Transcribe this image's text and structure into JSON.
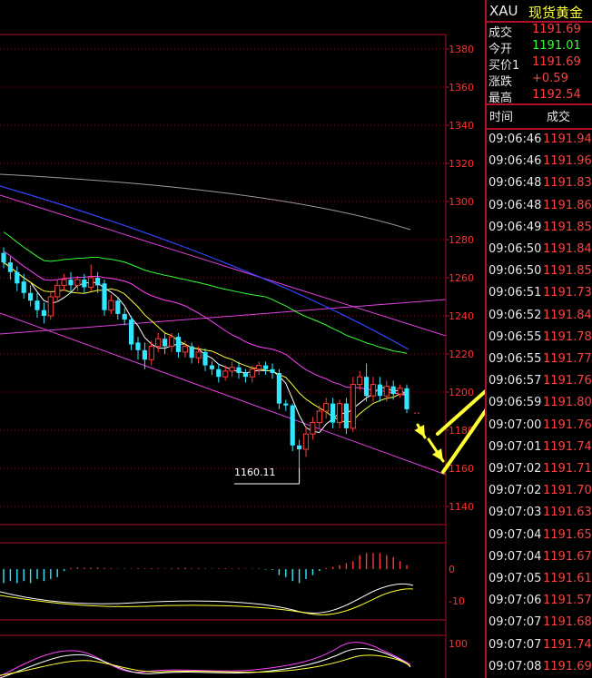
{
  "colors": {
    "up": "#ff3a3a",
    "down": "#33e6ff",
    "axis": "#b0102a",
    "grid": "#7a0f20",
    "price_up": "#ff4040",
    "price_down": "#33ff33",
    "arrow": "#ffff33"
  },
  "quote": {
    "symbol": "XAU",
    "name": "现货黄金",
    "rows": [
      {
        "label": "成交",
        "value": "1191.69",
        "color": "#ff4040"
      },
      {
        "label": "今开",
        "value": "1191.01",
        "color": "#33ff33"
      },
      {
        "label": "买价1",
        "value": "1191.69",
        "color": "#ff4040"
      },
      {
        "label": "涨跌",
        "value": "+0.59",
        "color": "#ff4040"
      },
      {
        "label": "最高",
        "value": "1192.54",
        "color": "#ff4040"
      }
    ],
    "tick_header": {
      "time": "时间",
      "price": "成交"
    },
    "ticks": [
      {
        "time": "09:06:46",
        "price": "1191.94"
      },
      {
        "time": "09:06:46",
        "price": "1191.96"
      },
      {
        "time": "09:06:48",
        "price": "1191.83"
      },
      {
        "time": "09:06:48",
        "price": "1191.86"
      },
      {
        "time": "09:06:49",
        "price": "1191.85"
      },
      {
        "time": "09:06:50",
        "price": "1191.84"
      },
      {
        "time": "09:06:50",
        "price": "1191.85"
      },
      {
        "time": "09:06:51",
        "price": "1191.73"
      },
      {
        "time": "09:06:52",
        "price": "1191.84"
      },
      {
        "time": "09:06:55",
        "price": "1191.78"
      },
      {
        "time": "09:06:55",
        "price": "1191.77"
      },
      {
        "time": "09:06:57",
        "price": "1191.76"
      },
      {
        "time": "09:06:59",
        "price": "1191.80"
      },
      {
        "time": "09:07:00",
        "price": "1191.76"
      },
      {
        "time": "09:07:01",
        "price": "1191.74"
      },
      {
        "time": "09:07:02",
        "price": "1191.71"
      },
      {
        "time": "09:07:02",
        "price": "1191.70"
      },
      {
        "time": "09:07:03",
        "price": "1191.63"
      },
      {
        "time": "09:07:04",
        "price": "1191.65"
      },
      {
        "time": "09:07:04",
        "price": "1191.67"
      },
      {
        "time": "09:07:05",
        "price": "1191.61"
      },
      {
        "time": "09:07:06",
        "price": "1191.57"
      },
      {
        "time": "09:07:07",
        "price": "1191.68"
      },
      {
        "time": "09:07:07",
        "price": "1191.74"
      },
      {
        "time": "09:07:08",
        "price": "1191.69"
      }
    ]
  },
  "chart": {
    "price_axis": [
      "1380",
      "1360",
      "1340",
      "1320",
      "1300",
      "1280",
      "1260",
      "1240",
      "1220",
      "1200",
      "1180",
      "1160",
      "1140"
    ],
    "low_annotation": "1160.11",
    "macd_axis": [
      "0",
      "-10"
    ],
    "kdj_axis": [
      "100"
    ],
    "candles": [
      {
        "o": 1273,
        "c": 1268,
        "h": 1276,
        "l": 1265
      },
      {
        "o": 1268,
        "c": 1263,
        "h": 1271,
        "l": 1259
      },
      {
        "o": 1263,
        "c": 1257,
        "h": 1266,
        "l": 1253
      },
      {
        "o": 1258,
        "c": 1252,
        "h": 1262,
        "l": 1249
      },
      {
        "o": 1252,
        "c": 1248,
        "h": 1256,
        "l": 1245
      },
      {
        "o": 1248,
        "c": 1243,
        "h": 1252,
        "l": 1239
      },
      {
        "o": 1243,
        "c": 1240,
        "h": 1247,
        "l": 1236
      },
      {
        "o": 1240,
        "c": 1250,
        "h": 1253,
        "l": 1238
      },
      {
        "o": 1250,
        "c": 1256,
        "h": 1259,
        "l": 1247
      },
      {
        "o": 1256,
        "c": 1259,
        "h": 1262,
        "l": 1253
      },
      {
        "o": 1259,
        "c": 1256,
        "h": 1263,
        "l": 1252
      },
      {
        "o": 1256,
        "c": 1259,
        "h": 1261,
        "l": 1253
      },
      {
        "o": 1259,
        "c": 1255,
        "h": 1262,
        "l": 1252
      },
      {
        "o": 1255,
        "c": 1260,
        "h": 1267,
        "l": 1253
      },
      {
        "o": 1260,
        "c": 1256,
        "h": 1263,
        "l": 1252
      },
      {
        "o": 1257,
        "c": 1243,
        "h": 1259,
        "l": 1240
      },
      {
        "o": 1243,
        "c": 1248,
        "h": 1251,
        "l": 1241
      },
      {
        "o": 1248,
        "c": 1241,
        "h": 1250,
        "l": 1238
      },
      {
        "o": 1241,
        "c": 1238,
        "h": 1244,
        "l": 1235
      },
      {
        "o": 1238,
        "c": 1225,
        "h": 1240,
        "l": 1222
      },
      {
        "o": 1226,
        "c": 1222,
        "h": 1229,
        "l": 1217
      },
      {
        "o": 1222,
        "c": 1217,
        "h": 1226,
        "l": 1212
      },
      {
        "o": 1217,
        "c": 1224,
        "h": 1227,
        "l": 1214
      },
      {
        "o": 1224,
        "c": 1228,
        "h": 1231,
        "l": 1221
      },
      {
        "o": 1228,
        "c": 1224,
        "h": 1231,
        "l": 1220
      },
      {
        "o": 1224,
        "c": 1229,
        "h": 1231,
        "l": 1221
      },
      {
        "o": 1229,
        "c": 1221,
        "h": 1231,
        "l": 1218
      },
      {
        "o": 1221,
        "c": 1224,
        "h": 1227,
        "l": 1218
      },
      {
        "o": 1224,
        "c": 1218,
        "h": 1226,
        "l": 1215
      },
      {
        "o": 1218,
        "c": 1221,
        "h": 1224,
        "l": 1215
      },
      {
        "o": 1221,
        "c": 1214,
        "h": 1223,
        "l": 1211
      },
      {
        "o": 1214,
        "c": 1212,
        "h": 1216,
        "l": 1209
      },
      {
        "o": 1212,
        "c": 1208,
        "h": 1215,
        "l": 1205
      },
      {
        "o": 1208,
        "c": 1211,
        "h": 1214,
        "l": 1206
      },
      {
        "o": 1211,
        "c": 1213,
        "h": 1216,
        "l": 1208
      },
      {
        "o": 1213,
        "c": 1210,
        "h": 1216,
        "l": 1207
      },
      {
        "o": 1210,
        "c": 1208,
        "h": 1212,
        "l": 1205
      },
      {
        "o": 1208,
        "c": 1212,
        "h": 1214,
        "l": 1205
      },
      {
        "o": 1212,
        "c": 1214,
        "h": 1216,
        "l": 1209
      },
      {
        "o": 1214,
        "c": 1212,
        "h": 1216,
        "l": 1209
      },
      {
        "o": 1212,
        "c": 1210,
        "h": 1215,
        "l": 1207
      },
      {
        "o": 1210,
        "c": 1194,
        "h": 1212,
        "l": 1191
      },
      {
        "o": 1194,
        "c": 1193,
        "h": 1196,
        "l": 1190
      },
      {
        "o": 1193,
        "c": 1172,
        "h": 1194,
        "l": 1169
      },
      {
        "o": 1172,
        "c": 1170,
        "h": 1175,
        "l": 1160
      },
      {
        "o": 1170,
        "c": 1178,
        "h": 1182,
        "l": 1166
      },
      {
        "o": 1178,
        "c": 1184,
        "h": 1187,
        "l": 1175
      },
      {
        "o": 1184,
        "c": 1190,
        "h": 1193,
        "l": 1181
      },
      {
        "o": 1190,
        "c": 1194,
        "h": 1197,
        "l": 1186
      },
      {
        "o": 1194,
        "c": 1184,
        "h": 1197,
        "l": 1181
      },
      {
        "o": 1184,
        "c": 1194,
        "h": 1196,
        "l": 1181
      },
      {
        "o": 1194,
        "c": 1181,
        "h": 1197,
        "l": 1178
      },
      {
        "o": 1181,
        "c": 1204,
        "h": 1208,
        "l": 1179
      },
      {
        "o": 1204,
        "c": 1208,
        "h": 1211,
        "l": 1201
      },
      {
        "o": 1208,
        "c": 1198,
        "h": 1215,
        "l": 1195
      },
      {
        "o": 1198,
        "c": 1204,
        "h": 1208,
        "l": 1195
      },
      {
        "o": 1204,
        "c": 1198,
        "h": 1208,
        "l": 1195
      },
      {
        "o": 1198,
        "c": 1203,
        "h": 1206,
        "l": 1195
      },
      {
        "o": 1203,
        "c": 1199,
        "h": 1206,
        "l": 1196
      },
      {
        "o": 1199,
        "c": 1202,
        "h": 1204,
        "l": 1197
      },
      {
        "o": 1202,
        "c": 1191,
        "h": 1204,
        "l": 1189
      }
    ],
    "macd_hist": [
      -7,
      -6,
      -7,
      -6,
      -7,
      -5,
      -6,
      -5,
      -4,
      -1,
      0.6,
      0.8,
      0.6,
      0.7,
      0.8,
      0.5,
      0.4,
      0.2,
      0.3,
      0.2,
      0.4,
      0.3,
      0.4,
      0.3,
      0.2,
      0.4,
      0.5,
      0.6,
      0.3,
      0.4,
      0.3,
      0.2,
      0.3,
      0.4,
      0.2,
      0.3,
      0.2,
      0.2,
      0.3,
      -0.3,
      -0.4,
      -3,
      -4,
      -6,
      -7,
      -5,
      -3,
      -1,
      0.5,
      1,
      2,
      3,
      4,
      7,
      8,
      8,
      8,
      7,
      6,
      4,
      2
    ]
  }
}
